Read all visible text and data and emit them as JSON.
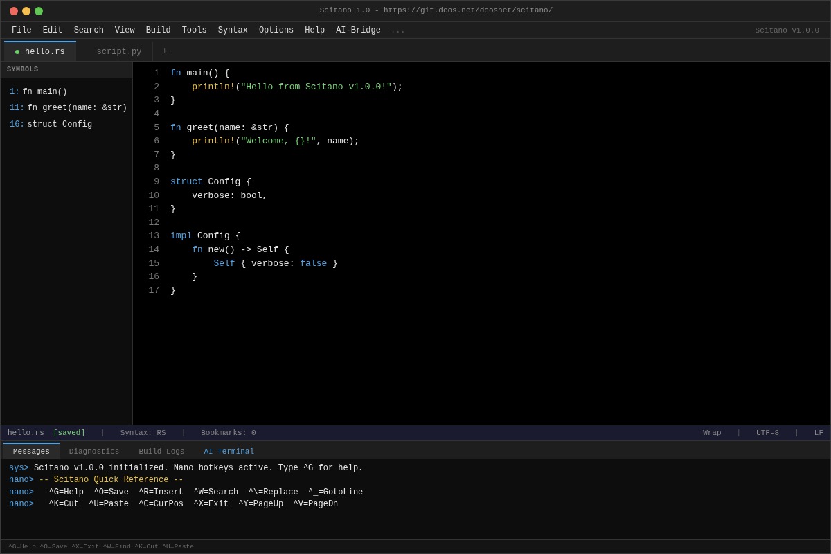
{
  "window": {
    "title": "Scitano 1.0 - https://git.dcos.net/dcosnet/scitano/"
  },
  "menu": {
    "items": [
      "File",
      "Edit",
      "Search",
      "View",
      "Build",
      "Tools",
      "Syntax",
      "Options",
      "Help",
      "AI-Bridge"
    ],
    "overflow": "...",
    "version": "Scitano v1.0.0"
  },
  "tabs": {
    "items": [
      {
        "label": "hello.rs",
        "selected": true,
        "marked": true
      },
      {
        "label": "script.py",
        "selected": false,
        "marked": false
      }
    ],
    "add": "+"
  },
  "sidebar": {
    "title": "SYMBOLS",
    "symbols": [
      {
        "line": "1:",
        "text": "fn main()"
      },
      {
        "line": "11:",
        "text": "fn greet(name: &str)"
      },
      {
        "line": "16:",
        "text": "struct Config"
      }
    ]
  },
  "editor": {
    "lines": [
      {
        "number": "1",
        "tokens": [
          {
            "kind": "keyword",
            "text": "fn"
          },
          {
            "kind": "plain",
            "text": " main() {"
          }
        ]
      },
      {
        "number": "2",
        "tokens": [
          {
            "kind": "macro",
            "text": "println!"
          },
          {
            "kind": "plain",
            "text": "("
          },
          {
            "kind": "string",
            "text": "\"Hello from Scitano v1.0.0!\""
          },
          {
            "kind": "plain",
            "text": ");"
          }
        ]
      },
      {
        "number": "3",
        "tokens": [
          {
            "kind": "plain",
            "text": "}"
          }
        ]
      },
      {
        "number": "4"
      },
      {
        "number": "5",
        "tokens": [
          {
            "kind": "keyword",
            "text": "fn"
          },
          {
            "kind": "plain",
            "text": " greet(name: &str) {"
          }
        ]
      },
      {
        "number": "6",
        "tokens": [
          {
            "kind": "macro",
            "text": "println!"
          },
          {
            "kind": "plain",
            "text": "("
          },
          {
            "kind": "string",
            "text": "\"Welcome, {}!\""
          },
          {
            "kind": "plain",
            "text": ", name);"
          }
        ]
      },
      {
        "number": "7",
        "tokens": [
          {
            "kind": "plain",
            "text": "}"
          }
        ]
      },
      {
        "number": "8"
      },
      {
        "number": "9",
        "tokens": [
          {
            "kind": "keyword",
            "text": "struct"
          },
          {
            "kind": "plain",
            "text": " Config {"
          }
        ]
      },
      {
        "number": "10",
        "tokens": [
          {
            "kind": "plain",
            "text": "verbose: bool,"
          }
        ]
      },
      {
        "number": "11",
        "tokens": [
          {
            "kind": "plain",
            "text": "}"
          }
        ]
      },
      {
        "number": "12"
      },
      {
        "number": "13",
        "tokens": [
          {
            "kind": "keyword",
            "text": "impl"
          },
          {
            "kind": "plain",
            "text": " Config {"
          }
        ]
      },
      {
        "number": "14",
        "tokens": [
          {
            "kind": "keyword",
            "text": "fn"
          },
          {
            "kind": "plain",
            "text": " new() -> Self {"
          }
        ]
      },
      {
        "number": "15",
        "tokens": [
          {
            "kind": "keyword",
            "text": "Self"
          },
          {
            "kind": "plain",
            "text": " { verbose: "
          },
          {
            "kind": "keyword",
            "text": "false"
          },
          {
            "kind": "plain",
            "text": " }"
          }
        ]
      },
      {
        "number": "16",
        "tokens": [
          {
            "kind": "plain",
            "text": "}"
          }
        ]
      },
      {
        "number": "17",
        "tokens": [
          {
            "kind": "plain",
            "text": "}"
          }
        ]
      }
    ]
  },
  "status_bar": {
    "left": [
      {
        "kind": "file",
        "text": "hello.rs"
      },
      {
        "kind": "saved",
        "text": "[saved]"
      },
      {
        "kind": "sep",
        "text": "|"
      },
      {
        "kind": "info",
        "text": "Syntax: RS"
      },
      {
        "kind": "sep",
        "text": "|"
      },
      {
        "kind": "info",
        "text": "Bookmarks: 0"
      }
    ],
    "right": [
      {
        "kind": "info",
        "text": "Wrap"
      },
      {
        "kind": "sep",
        "text": "|"
      },
      {
        "kind": "info",
        "text": "UTF-8"
      },
      {
        "kind": "sep",
        "text": "|"
      },
      {
        "kind": "info",
        "text": "LF"
      }
    ]
  },
  "panel": {
    "tabs": [
      {
        "label": "Messages",
        "selected": true,
        "kind": "normal"
      },
      {
        "label": "Diagnostics",
        "selected": false,
        "kind": "normal"
      },
      {
        "label": "Build Logs",
        "selected": false,
        "kind": "normal"
      },
      {
        "label": "AI Terminal",
        "selected": false,
        "kind": "accent"
      }
    ],
    "messages": [
      {
        "prompt": "sys>",
        "kind": "normal",
        "text": "Scitano v1.0.0 initialized. Nano hotkeys active. Type ^G for help."
      },
      {
        "prompt": "nano>",
        "kind": "heading",
        "text": "-- Scitano Quick Reference --"
      },
      {
        "prompt": "nano>",
        "kind": "normal",
        "text": "  ^G=Help  ^O=Save  ^R=Insert  ^W=Search  ^\\=Replace  ^_=GotoLine"
      },
      {
        "prompt": "nano>",
        "kind": "normal",
        "text": "  ^K=Cut  ^U=Paste  ^C=CurPos  ^X=Exit  ^Y=PageUp  ^V=PageDn"
      }
    ]
  },
  "footer": {
    "hint": "^G=Help ^O=Save ^X=Exit ^W=Find ^K=Cut ^U=Paste"
  }
}
